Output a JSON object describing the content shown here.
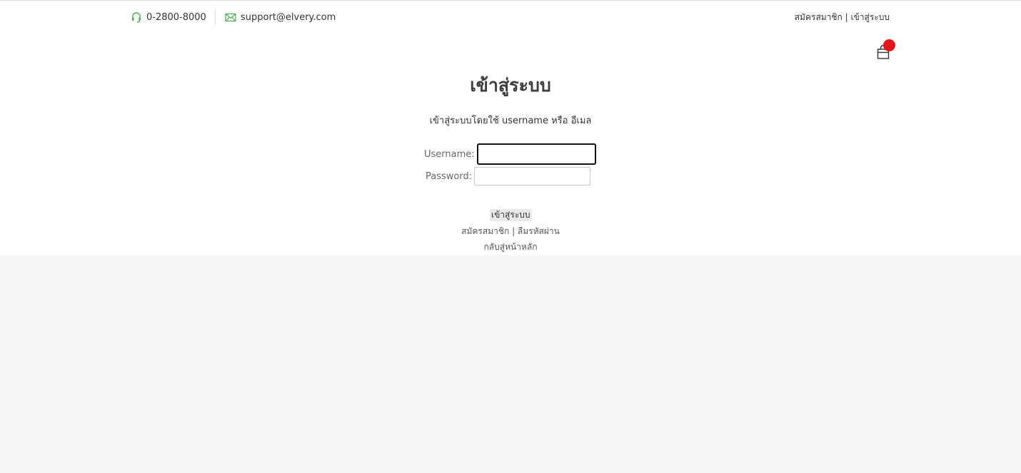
{
  "topbar": {
    "phone": "0-2800-8000",
    "phone_icon": "headset-icon",
    "email": "support@elvery.com",
    "email_icon": "envelope-icon",
    "icon_color": "#4caf50",
    "register_link": "สมัครสมาชิก",
    "separator": " | ",
    "login_link": "เข้าสู่ระบบ"
  },
  "cart": {
    "icon": "shopping-bag-icon",
    "badge_color": "#e4141b"
  },
  "login": {
    "title": "เข้าสู่ระบบ",
    "subtitle": "เข้าสู่ระบบโดยใช้ username หรือ อีเมล",
    "username_label": "Username:",
    "username_value": "",
    "password_label": "Password:",
    "password_value": "",
    "submit_label": "เข้าสู่ระบบ",
    "register_link": "สมัครสมาชิก",
    "links_separator": " | ",
    "forgot_password_link": "ลืมรหัสผ่าน",
    "back_home_link": "กลับสู่หน้าหลัก"
  }
}
